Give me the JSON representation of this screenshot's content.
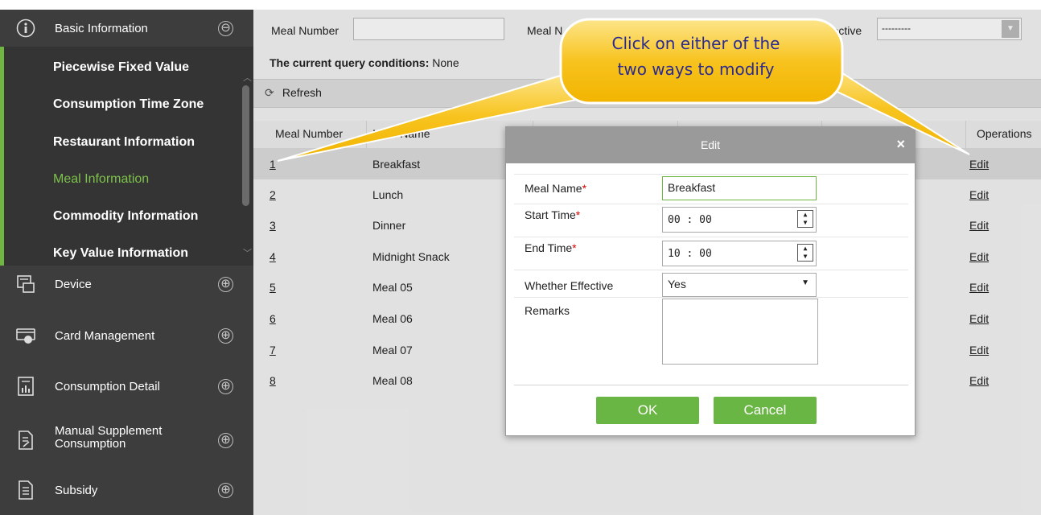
{
  "sidebar": {
    "groups": [
      {
        "label": "Basic Information",
        "icon": "info-icon",
        "toggle": "⊖"
      },
      {
        "label": "Device",
        "icon": "device-icon",
        "toggle": "⊕"
      },
      {
        "label": "Card Management",
        "icon": "card-icon",
        "toggle": "⊕"
      },
      {
        "label": "Consumption Detail",
        "icon": "report-icon",
        "toggle": "⊕"
      },
      {
        "label": "Manual Supplement Consumption",
        "icon": "document-edit-icon",
        "toggle": "⊕"
      },
      {
        "label": "Subsidy",
        "icon": "document-list-icon",
        "toggle": "⊕"
      }
    ],
    "sub_items": [
      {
        "label": "Piecewise Fixed Value"
      },
      {
        "label": "Consumption Time Zone"
      },
      {
        "label": "Restaurant Information"
      },
      {
        "label": "Meal Information"
      },
      {
        "label": "Commodity Information"
      },
      {
        "label": "Key Value Information"
      }
    ],
    "active_item": "Meal Information",
    "colors": {
      "bg": "#3d3d3d",
      "accent": "#6fb643"
    }
  },
  "search": {
    "meal_number_label": "Meal Number",
    "meal_name_label_partial": "Meal N",
    "effective_label_partial": "ffective",
    "effective_value": "---------"
  },
  "query": {
    "prefix": "The current query conditions:",
    "value": "None"
  },
  "toolbar": {
    "refresh_label": "Refresh"
  },
  "table": {
    "headers": {
      "meal_number": "Meal Number",
      "meal_name": "Meal Name",
      "operations": "Operations"
    },
    "rows": [
      {
        "number": "1",
        "name": "Breakfast",
        "op": "Edit"
      },
      {
        "number": "2",
        "name": "Lunch",
        "op": "Edit"
      },
      {
        "number": "3",
        "name": "Dinner",
        "op": "Edit"
      },
      {
        "number": "4",
        "name": "Midnight Snack",
        "op": "Edit"
      },
      {
        "number": "5",
        "name": "Meal 05",
        "op": "Edit"
      },
      {
        "number": "6",
        "name": "Meal 06",
        "op": "Edit"
      },
      {
        "number": "7",
        "name": "Meal 07",
        "op": "Edit"
      },
      {
        "number": "8",
        "name": "Meal 08",
        "op": "Edit"
      }
    ]
  },
  "dialog": {
    "title": "Edit",
    "close": "×",
    "fields": {
      "meal_name": {
        "label": "Meal Name",
        "required": "*",
        "value": "Breakfast"
      },
      "start_time": {
        "label": "Start Time",
        "required": "*",
        "value": "00 : 00"
      },
      "end_time": {
        "label": "End Time",
        "required": "*",
        "value": "10 : 00"
      },
      "effective": {
        "label": "Whether Effective",
        "value": "Yes"
      },
      "remarks": {
        "label": "Remarks",
        "value": ""
      }
    },
    "ok_label": "OK",
    "cancel_label": "Cancel",
    "button_color": "#6ab644"
  },
  "callout": {
    "line1": "Click on either of the",
    "line2": "two ways to modify",
    "color": "#f7c31e"
  }
}
